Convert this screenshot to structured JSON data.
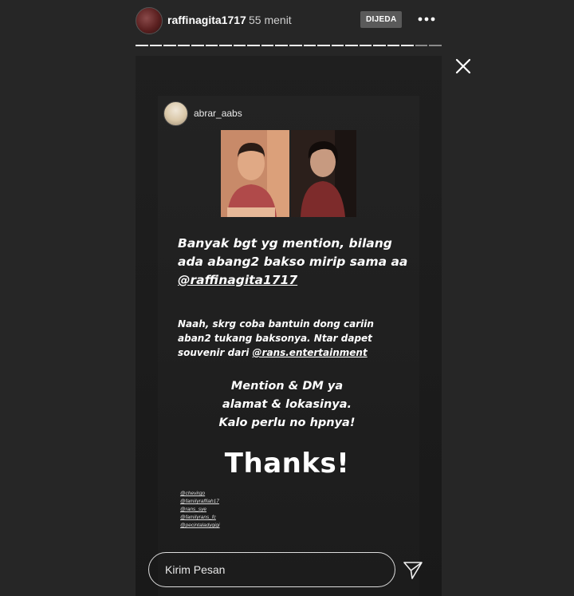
{
  "header": {
    "username": "raffinagita1717",
    "time_ago": "55 menit",
    "paused_badge": "DIJEDA",
    "progress": {
      "total": 22,
      "current_index": 19
    }
  },
  "story": {
    "shared_post": {
      "username": "abrar_aabs"
    },
    "text": {
      "line1a": "Banyak bgt yg mention, bilang",
      "line1b": "ada abang2 bakso mirip sama aa",
      "line1_mention": "@raffinagita1717",
      "line2a": "Naah, skrg coba bantuin dong cariin",
      "line2b": "aban2 tukang baksonya. Ntar dapet",
      "line2c": "souvenir dari ",
      "line2_mention": "@rans.entertainment",
      "line3a": "Mention & DM ya",
      "line3b": "alamat & lokasinya.",
      "line3c": "Kalo perlu no hpnya!",
      "thanks": "Thanks!"
    },
    "tags": [
      "@chevirgo",
      "@familyraffiah17",
      "@rans_sye",
      "@familyrans_fc",
      "@pecintaladygigi"
    ]
  },
  "reply": {
    "placeholder": "Kirim Pesan"
  },
  "icons": {
    "more": "more-horizontal-icon",
    "close": "close-icon",
    "send": "send-paper-plane-icon"
  }
}
